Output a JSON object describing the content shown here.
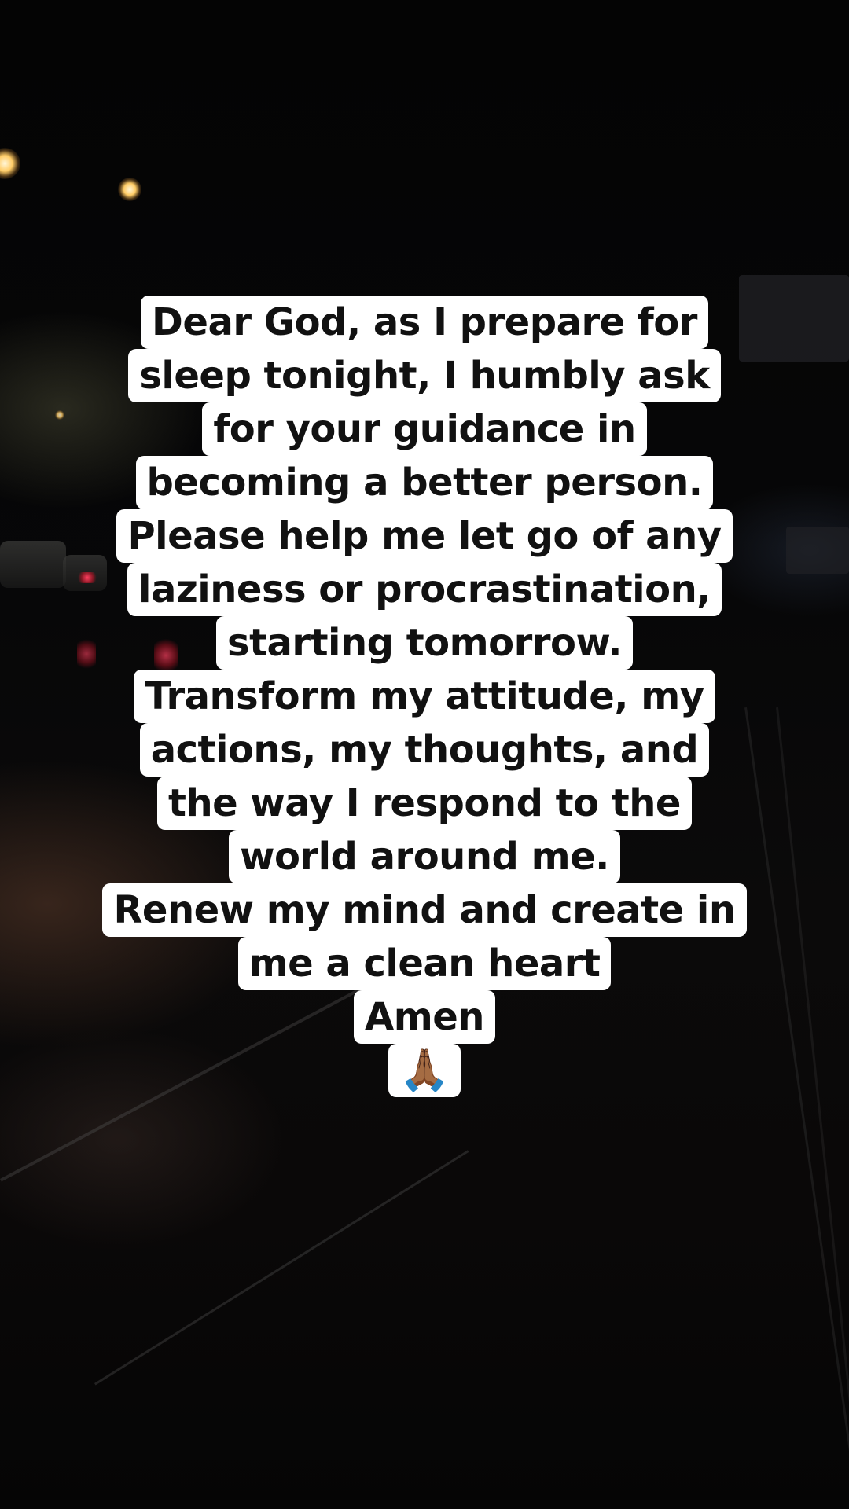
{
  "caption": {
    "lines": [
      "Dear God, as I prepare for",
      "sleep tonight, I humbly ask",
      "for your guidance in",
      "becoming a better person.",
      "Please help me let go of any",
      "laziness or procrastination,",
      "starting tomorrow.",
      "Transform my attitude, my",
      "actions, my thoughts, and",
      "the way I respond to the",
      "world around me.",
      "Renew my mind and create in",
      "me a clean heart",
      "Amen",
      "🙏🏾"
    ]
  },
  "icons": {
    "prayer_hands": "praying-hands-icon",
    "road_sign": "chevron-up-sign-icon"
  },
  "colors": {
    "caption_background": "#ffffff",
    "caption_text": "#111111",
    "scene_background": "#050505"
  }
}
